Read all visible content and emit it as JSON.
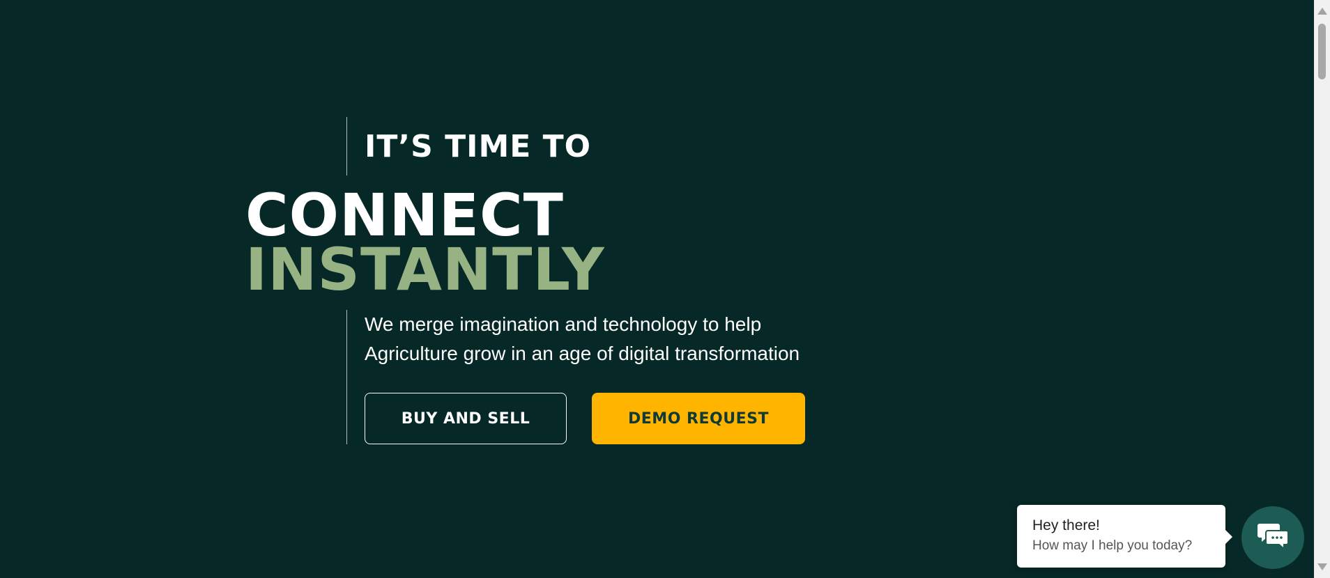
{
  "hero": {
    "eyebrow": "IT’S TIME TO",
    "headline_line1": "CONNECT",
    "headline_line2": "INSTANTLY",
    "lede_line1": "We merge imagination and technology to help",
    "lede_line2": "Agriculture grow in an age of digital transformation",
    "primary_cta": "BUY AND SELL",
    "secondary_cta": "DEMO REQUEST"
  },
  "chat": {
    "greeting": "Hey there!",
    "prompt": "How may I help you today?",
    "launcher_icon": "chat-icon"
  },
  "colors": {
    "background": "#062826",
    "accent_green": "#97b283",
    "cta_yellow": "#ffb400",
    "chat_launcher": "#1d5c54"
  }
}
